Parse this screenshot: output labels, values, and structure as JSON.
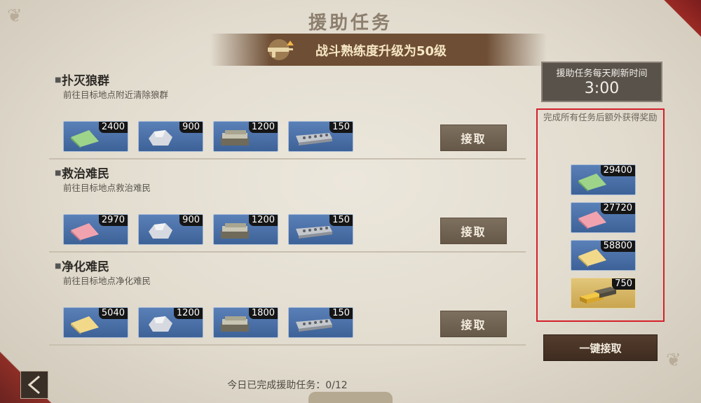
{
  "title": "援助任务",
  "banner": {
    "text": "战斗熟练度升级为50级",
    "icon": "rifle-upgrade-icon"
  },
  "tasks": [
    {
      "name": "扑灭狼群",
      "desc": "前往目标地点附近清除狼群",
      "accept_label": "接取",
      "rewards": [
        {
          "icon": "green-ticket-icon",
          "count": "2400"
        },
        {
          "icon": "silver-ore-icon",
          "count": "900"
        },
        {
          "icon": "cash-stack-icon",
          "count": "1200"
        },
        {
          "icon": "steel-block-icon",
          "count": "150"
        }
      ]
    },
    {
      "name": "救治难民",
      "desc": "前往目标地点救治难民",
      "accept_label": "接取",
      "rewards": [
        {
          "icon": "pink-ticket-icon",
          "count": "2970"
        },
        {
          "icon": "silver-ore-icon",
          "count": "900"
        },
        {
          "icon": "cash-stack-icon",
          "count": "1200"
        },
        {
          "icon": "steel-block-icon",
          "count": "150"
        }
      ]
    },
    {
      "name": "净化难民",
      "desc": "前往目标地点净化难民",
      "accept_label": "接取",
      "rewards": [
        {
          "icon": "yellow-ticket-icon",
          "count": "5040"
        },
        {
          "icon": "silver-ore-icon",
          "count": "1200"
        },
        {
          "icon": "cash-stack-icon",
          "count": "1800"
        },
        {
          "icon": "steel-block-icon",
          "count": "150"
        }
      ]
    }
  ],
  "refresh": {
    "label": "援助任务每天刷新时间",
    "time": "3:00"
  },
  "bonus": {
    "label": "完成所有任务后额外获得奖励",
    "rewards": [
      {
        "icon": "green-ticket-icon",
        "count": "29400"
      },
      {
        "icon": "pink-ticket-icon",
        "count": "27720"
      },
      {
        "icon": "yellow-ticket-icon",
        "count": "58800"
      },
      {
        "icon": "gold-bars-icon",
        "count": "750"
      }
    ]
  },
  "claim_all_label": "一键接取",
  "status": "今日已完成援助任务：0/12",
  "colors": {
    "highlight_border": "#d4202a",
    "panel_bg": "#e6e0d4",
    "button_brown": "#6e6050"
  }
}
